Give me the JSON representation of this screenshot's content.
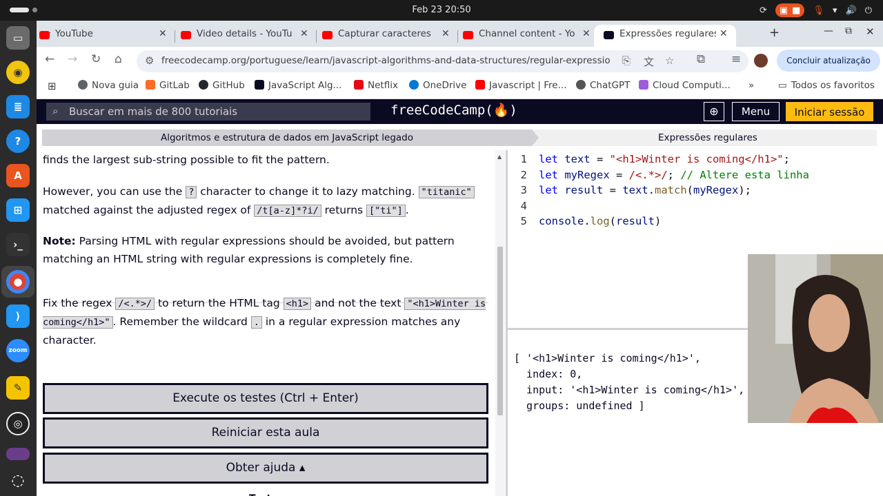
{
  "system": {
    "clock": "Feb 23  20:50"
  },
  "tabs": [
    {
      "label": "YouTube",
      "color": "#ff0000"
    },
    {
      "label": "Video details - YouTu",
      "color": "#ff0000"
    },
    {
      "label": "Capturar caracteres q",
      "color": "#ff0000"
    },
    {
      "label": "Channel content - Yo",
      "color": "#ff0000"
    },
    {
      "label": "Expressões regulares",
      "color": "#0a0a23",
      "active": true
    }
  ],
  "navbar": {
    "url": "freecodecamp.org/portuguese/learn/javascript-algorithms-and-data-structures/regular-expressions/find-char...",
    "update_button": "Concluir atualização"
  },
  "bookmarks": [
    "Nova guia",
    "GitLab",
    "GitHub",
    "JavaScript Alg...",
    "Netflix",
    "OneDrive",
    "Javascript | Fre...",
    "ChatGPT",
    "Cloud Computi...",
    "Todos os favoritos"
  ],
  "fcc": {
    "search_placeholder": "Buscar em mais de 800 tutoriais",
    "logo": "freeCodeCamp(🔥)",
    "menu": "Menu",
    "signin": "Iniciar sessão",
    "breadcrumb_1": "Algoritmos e estrutura de dados em JavaScript legado",
    "breadcrumb_2": "Expressões regulares"
  },
  "lesson": {
    "p1": "finds the largest sub-string possible to fit the pattern.",
    "p2a": "However, you can use the ",
    "p2_code1": "?",
    "p2b": " character to change it to lazy matching. ",
    "p2_code2": "\"titanic\"",
    "p2c": "matched against the adjusted regex of ",
    "p2_code3": "/t[a-z]*?i/",
    "p2d": " returns ",
    "p2_code4": "[\"ti\"]",
    "p2e": ".",
    "note_label": "Note:",
    "note_text": " Parsing HTML with regular expressions should be avoided, but pattern matching an HTML string with regular expressions is completely fine.",
    "p4a": "Fix the regex ",
    "p4_code1": "/<.*>/",
    "p4b": " to return the HTML tag ",
    "p4_code2": "<h1>",
    "p4c": " and not the text ",
    "p4_code3": "\"<h1>Winter is coming</h1>\"",
    "p4d": ". Remember the wildcard ",
    "p4_code4": ".",
    "p4e": " in a regular expression matches any character.",
    "run_button": "Execute os testes (Ctrl + Enter)",
    "reset_button": "Reiniciar esta aula",
    "help_button": "Obter ajuda ▴",
    "tests_heading": "Testes"
  },
  "editor": {
    "lines": [
      {
        "n": "1",
        "parts": [
          [
            "kw",
            "let "
          ],
          [
            "va",
            "text"
          ],
          [
            "",
            " = "
          ],
          [
            "str",
            "\"<h1>Winter is coming</h1>\""
          ],
          [
            "",
            ";"
          ]
        ]
      },
      {
        "n": "2",
        "parts": [
          [
            "kw",
            "let "
          ],
          [
            "va",
            "myRegex"
          ],
          [
            "",
            " = "
          ],
          [
            "str",
            "/<.*>/"
          ],
          [
            "",
            "; "
          ],
          [
            "cm",
            "// Altere esta linha"
          ]
        ]
      },
      {
        "n": "3",
        "parts": [
          [
            "kw",
            "let "
          ],
          [
            "va",
            "result"
          ],
          [
            "",
            " = "
          ],
          [
            "va",
            "text"
          ],
          [
            "",
            "."
          ],
          [
            "fn",
            "match"
          ],
          [
            "",
            "("
          ],
          [
            "va",
            "myRegex"
          ],
          [
            "",
            ");"
          ]
        ]
      },
      {
        "n": "4",
        "parts": []
      },
      {
        "n": "5",
        "parts": [
          [
            "va",
            "console"
          ],
          [
            "",
            "."
          ],
          [
            "fn",
            "log"
          ],
          [
            "",
            "("
          ],
          [
            "va",
            "result"
          ],
          [
            "",
            ")"
          ]
        ]
      }
    ]
  },
  "console": {
    "lines": [
      "[ '<h1>Winter is coming</h1>',",
      "  index: 0,",
      "  input: '<h1>Winter is coming</h1>',",
      "  groups: undefined ]"
    ]
  }
}
